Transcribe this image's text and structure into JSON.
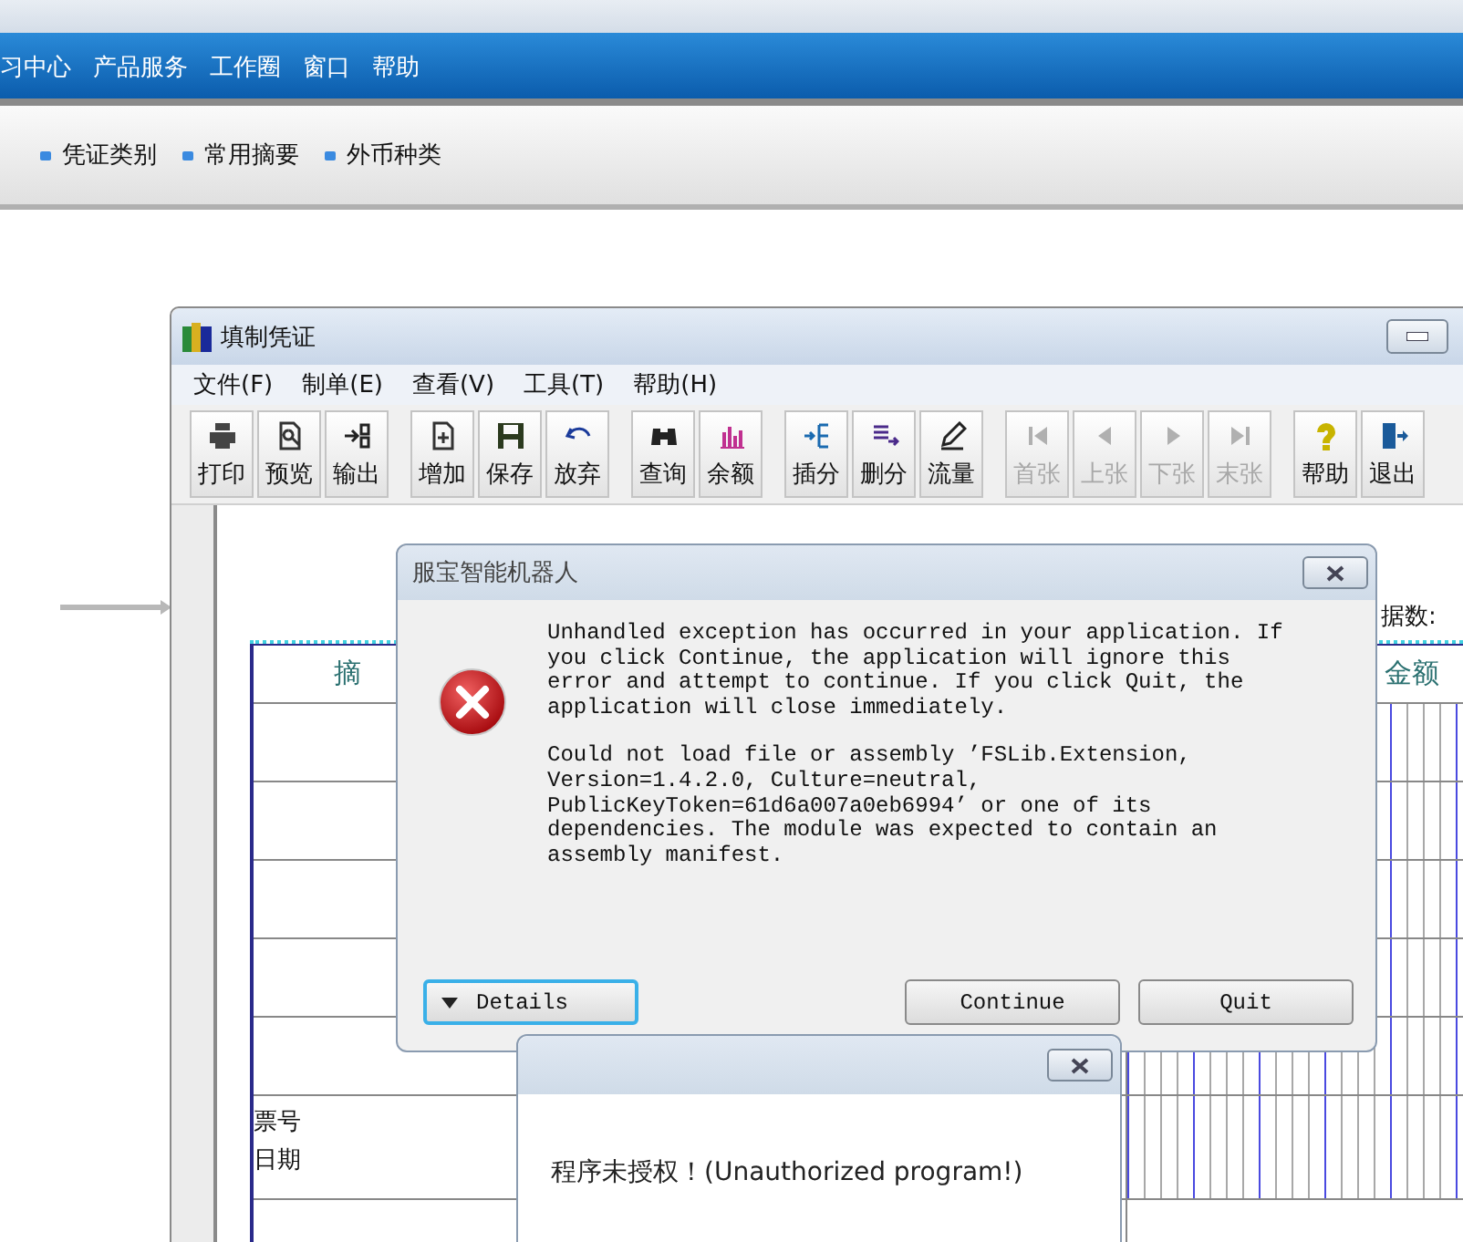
{
  "top_menu": [
    "习中心",
    "产品服务",
    "工作圈",
    "窗口",
    "帮助"
  ],
  "main_toolbar": [
    "凭证类别",
    "常用摘要",
    "外币种类"
  ],
  "voucher_window": {
    "title": "填制凭证",
    "menu": [
      "文件(F)",
      "制单(E)",
      "查看(V)",
      "工具(T)",
      "帮助(H)"
    ],
    "toolbar": [
      [
        {
          "label": "打印",
          "disabled": false
        },
        {
          "label": "预览",
          "disabled": false
        },
        {
          "label": "输出",
          "disabled": false
        }
      ],
      [
        {
          "label": "增加",
          "disabled": false
        },
        {
          "label": "保存",
          "disabled": false
        },
        {
          "label": "放弃",
          "disabled": false
        }
      ],
      [
        {
          "label": "查询",
          "disabled": false
        },
        {
          "label": "余额",
          "disabled": false
        }
      ],
      [
        {
          "label": "插分",
          "disabled": false
        },
        {
          "label": "删分",
          "disabled": false
        },
        {
          "label": "流量",
          "disabled": false
        }
      ],
      [
        {
          "label": "首张",
          "disabled": true
        },
        {
          "label": "上张",
          "disabled": true
        },
        {
          "label": "下张",
          "disabled": true
        },
        {
          "label": "末张",
          "disabled": true
        }
      ],
      [
        {
          "label": "帮助",
          "disabled": false
        },
        {
          "label": "退出",
          "disabled": false
        }
      ]
    ],
    "doc_count_label": "据数:",
    "table": {
      "summary_header": "摘",
      "amount_header": "金额",
      "ticket_labels": [
        "票号",
        "日期"
      ]
    }
  },
  "error_dialog": {
    "title": "服宝智能机器人",
    "message": [
      "Unhandled exception has occurred in your application. If you click Continue, the application will ignore this error and attempt to continue. If you click Quit, the application will close immediately.",
      "Could not load file or assembly ’FSLib.Extension, Version=1.4.2.0, Culture=neutral, PublicKeyToken=61d6a007a0eb6994’ or one of its dependencies. The module was expected to contain an assembly manifest."
    ],
    "buttons": [
      {
        "kind": "expander",
        "label": "Details",
        "focused": true
      },
      {
        "kind": "push",
        "label": "Continue",
        "focused": false
      },
      {
        "kind": "push",
        "label": "Quit",
        "focused": false
      }
    ]
  },
  "auth_dialog": {
    "message": "程序未授权！(Unauthorized program!)"
  }
}
